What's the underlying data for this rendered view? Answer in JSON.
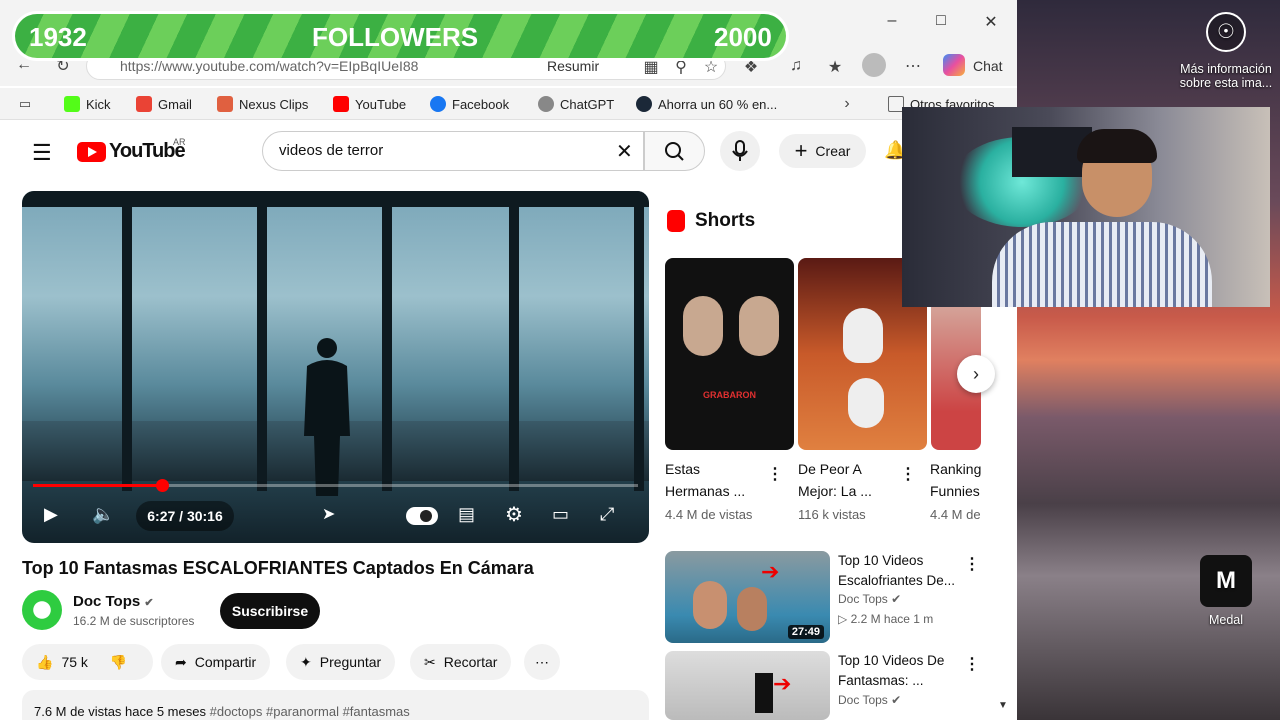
{
  "overlay": {
    "current": "1932",
    "label": "FOLLOWERS",
    "goal": "2000",
    "progress_fraction": 0.966
  },
  "browser": {
    "url": "https://www.youtube.com/watch?v=EIpBqIUeI88",
    "resumir_label": "Resumir",
    "chat_label": "Chat",
    "bookmarks": [
      "Kick",
      "Gmail",
      "Nexus Clips",
      "YouTube",
      "Facebook",
      "ChatGPT",
      "Ahorra un 60 % en..."
    ],
    "other_favorites": "Otros favoritos"
  },
  "youtube": {
    "logo": "YouTube",
    "region": "AR",
    "search_value": "videos de terror",
    "create_label": "Crear",
    "player": {
      "time": "6:27 / 30:16",
      "progress_fraction": 0.213
    },
    "video_title": "Top 10 Fantasmas ESCALOFRIANTES Captados En Cámara",
    "channel": {
      "name": "Doc Tops",
      "subs": "16.2 M de suscriptores"
    },
    "subscribe_label": "Suscribirse",
    "actions": {
      "likes": "75 k",
      "share": "Compartir",
      "ask": "Preguntar",
      "clip": "Recortar"
    },
    "description": {
      "stats": "7.6 M de vistas  hace 5 meses",
      "tags": "#doctops #paranormal #fantasmas"
    },
    "shorts_label": "Shorts",
    "shorts": [
      {
        "title_1": "Estas",
        "title_2": "Hermanas ...",
        "views": "4.4 M de vistas",
        "thumb_text": "GRABARON"
      },
      {
        "title_1": "De Peor A",
        "title_2": "Mejor: La ...",
        "views": "116 k vistas"
      },
      {
        "title_1": "Ranking",
        "title_2": "Funnies",
        "views": "4.4 M de"
      }
    ],
    "recommended": [
      {
        "title_1": "Top 10 Videos",
        "title_2": "Escalofriantes De...",
        "channel": "Doc Tops",
        "meta": "2.2 M  hace 1 m",
        "duration": "27:49"
      },
      {
        "title_1": "Top 10 Videos De",
        "title_2": "Fantasmas: ...",
        "channel": "Doc Tops",
        "meta": ""
      }
    ]
  },
  "desktop": {
    "info_label": "Más información sobre esta ima...",
    "medal_label": "Medal"
  }
}
